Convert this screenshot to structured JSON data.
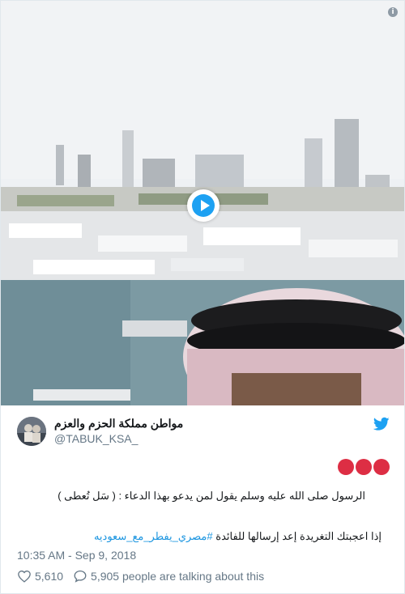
{
  "media": {
    "info_icon": "info-icon",
    "play_icon": "play-icon"
  },
  "tweet": {
    "display_name": "مواطن مملكة الحزم والعزم",
    "screen_name": "@TABUK_KSA_",
    "line1": "الرسول صلى الله عليه وسلم يقول لمن يدعو بهذا الدعاء : ( سَل تُعطى )",
    "line2_prefix": "إذا اعجبتك التغريدة إعد إرسالها للفائدة",
    "hashtag": "#مصري_يفطر_مع_سعوديه",
    "emoji_count": 3,
    "emoji_color": "#dd2e44",
    "timestamp": "10:35 AM - Sep 9, 2018"
  },
  "actions": {
    "likes": "5,610",
    "replies_text": "5,905 people are talking about this"
  },
  "colors": {
    "brand": "#1da1f2",
    "link": "#1b95e0",
    "muted": "#657786"
  }
}
